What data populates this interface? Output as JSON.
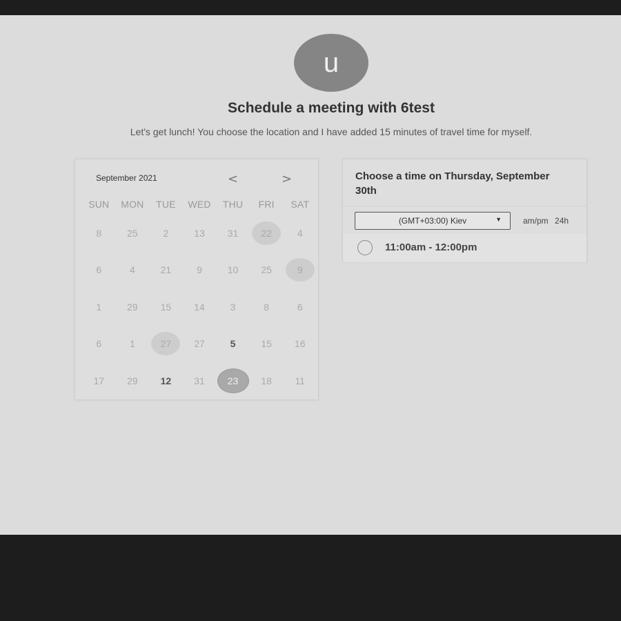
{
  "avatar": {
    "initial": "u"
  },
  "header": {
    "title": "Schedule a meeting with 6test",
    "description": "Let's get lunch! You choose the location and I have added 15 minutes of travel time for myself."
  },
  "calendar": {
    "month_label": "September 2021",
    "prev_glyph": "<",
    "next_glyph": ">",
    "weekdays": [
      "SUN",
      "MON",
      "TUE",
      "WED",
      "THU",
      "FRI",
      "SAT"
    ],
    "days": [
      {
        "label": "8",
        "state": "disabled"
      },
      {
        "label": "25",
        "state": "disabled"
      },
      {
        "label": "2",
        "state": "disabled"
      },
      {
        "label": "13",
        "state": "disabled"
      },
      {
        "label": "31",
        "state": "disabled"
      },
      {
        "label": "22",
        "state": "shaded"
      },
      {
        "label": "4",
        "state": "disabled"
      },
      {
        "label": "6",
        "state": "disabled"
      },
      {
        "label": "4",
        "state": "disabled"
      },
      {
        "label": "21",
        "state": "disabled"
      },
      {
        "label": "9",
        "state": "disabled"
      },
      {
        "label": "10",
        "state": "disabled"
      },
      {
        "label": "25",
        "state": "disabled"
      },
      {
        "label": "9",
        "state": "shaded"
      },
      {
        "label": "1",
        "state": "disabled"
      },
      {
        "label": "29",
        "state": "disabled"
      },
      {
        "label": "15",
        "state": "disabled"
      },
      {
        "label": "14",
        "state": "disabled"
      },
      {
        "label": "3",
        "state": "disabled"
      },
      {
        "label": "8",
        "state": "disabled"
      },
      {
        "label": "6",
        "state": "disabled"
      },
      {
        "label": "6",
        "state": "disabled"
      },
      {
        "label": "1",
        "state": "disabled"
      },
      {
        "label": "27",
        "state": "shaded"
      },
      {
        "label": "27",
        "state": "disabled"
      },
      {
        "label": "5",
        "state": "available"
      },
      {
        "label": "15",
        "state": "disabled"
      },
      {
        "label": "16",
        "state": "disabled"
      },
      {
        "label": "17",
        "state": "disabled"
      },
      {
        "label": "29",
        "state": "disabled"
      },
      {
        "label": "12",
        "state": "available"
      },
      {
        "label": "31",
        "state": "disabled"
      },
      {
        "label": "23",
        "state": "selected"
      },
      {
        "label": "18",
        "state": "disabled"
      },
      {
        "label": "11",
        "state": "disabled"
      }
    ]
  },
  "times": {
    "title": "Choose a time on Thursday, September 30th",
    "timezone": "(GMT+03:00) Kiev",
    "format_ampm": "am/pm",
    "format_24h": "24h",
    "slots": [
      "11:00am - 12:00pm"
    ]
  }
}
